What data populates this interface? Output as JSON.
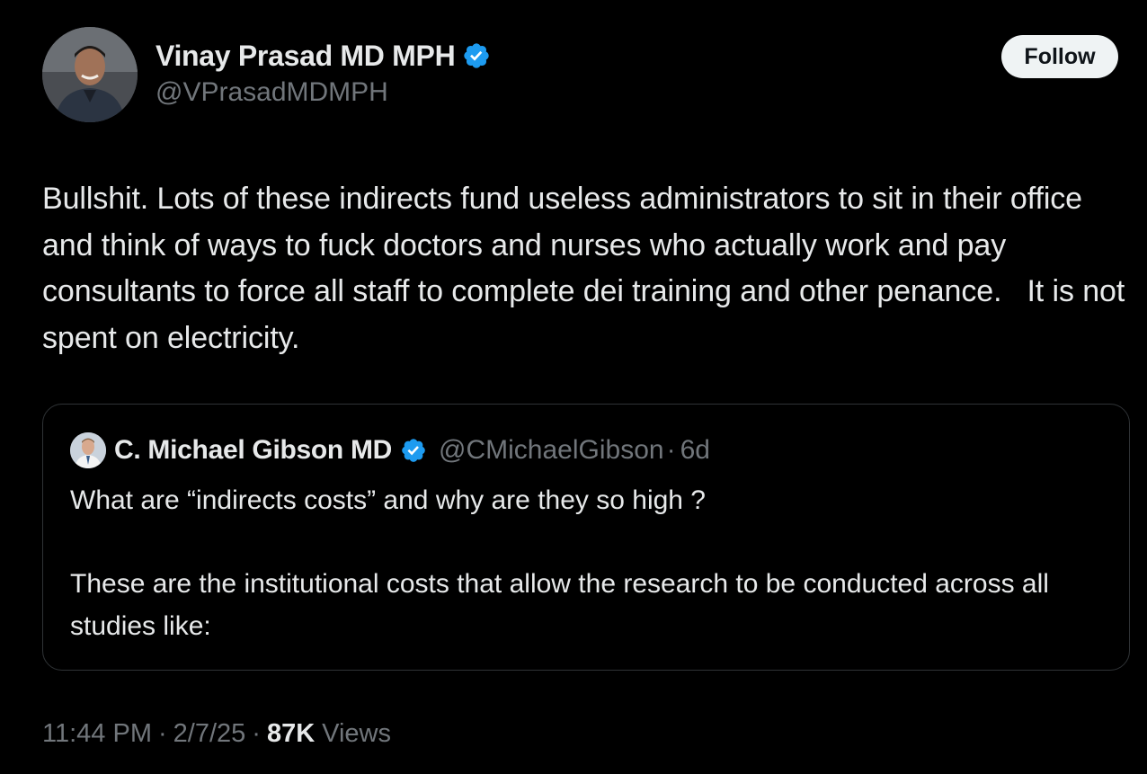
{
  "colors": {
    "background": "#000000",
    "primary_text": "#e7e9ea",
    "secondary_text": "#71767b",
    "verified_badge": "#1d9bf0",
    "follow_button_bg": "#eff3f4",
    "follow_button_text": "#0f1419",
    "quote_border": "#2f3336"
  },
  "author": {
    "avatar_icon": "user-avatar",
    "name": "Vinay Prasad MD MPH",
    "handle": "@VPrasadMDMPH",
    "verified_icon": "verified-badge-icon"
  },
  "follow_button": {
    "label": "Follow"
  },
  "tweet": {
    "text": "Bullshit. Lots of these indirects fund useless administrators to sit in their office and think of ways to fuck doctors and nurses who actually work and pay consultants to force all staff to complete dei training and other penance.   It is not spent on electricity."
  },
  "quoted_tweet": {
    "avatar_icon": "user-avatar",
    "name": "C. Michael Gibson MD",
    "verified_icon": "verified-badge-icon",
    "handle": "@CMichaelGibson",
    "separator": "·",
    "time": "6d",
    "text": "What are “indirects costs” and why are they so high ?\n\nThese are the institutional costs that allow the research to be conducted across all studies like:"
  },
  "meta": {
    "time": "11:44 PM",
    "separator": "·",
    "date": "2/7/25",
    "views_count": "87K",
    "views_label": "Views"
  }
}
